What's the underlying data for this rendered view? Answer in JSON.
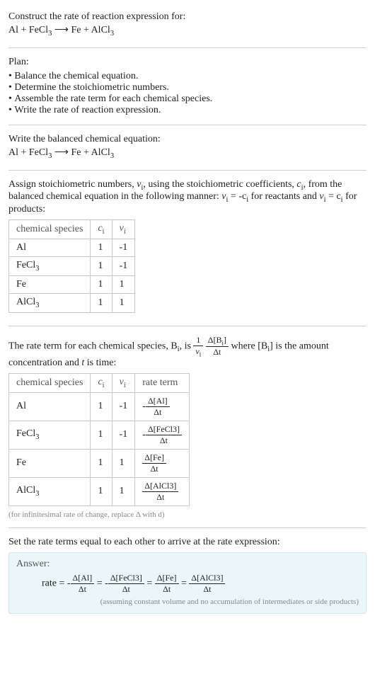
{
  "intro": {
    "title": "Construct the rate of reaction expression for:",
    "equation_lhs": "Al + FeCl",
    "equation_rhs": "Fe + AlCl",
    "sub3": "3",
    "arrow": " ⟶ "
  },
  "plan": {
    "heading": "Plan:",
    "items": [
      "Balance the chemical equation.",
      "Determine the stoichiometric numbers.",
      "Assemble the rate term for each chemical species.",
      "Write the rate of reaction expression."
    ]
  },
  "balanced": {
    "heading": "Write the balanced chemical equation:",
    "equation_lhs": "Al + FeCl",
    "equation_rhs": "Fe + AlCl",
    "sub3": "3",
    "arrow": " ⟶ "
  },
  "assign": {
    "text1": "Assign stoichiometric numbers, ",
    "nu_i": "ν",
    "sub_i": "i",
    "text2": ", using the stoichiometric coefficients, ",
    "c_i": "c",
    "text3": ", from the balanced chemical equation in the following manner: ",
    "rel_reactants_a": "ν",
    "rel_reactants_b": " = -c",
    "rel_reactants_c": " for reactants and ",
    "rel_products_a": "ν",
    "rel_products_b": " = c",
    "rel_products_c": " for products:"
  },
  "table1": {
    "headers": [
      "chemical species",
      "c",
      "ν"
    ],
    "sub_i": "i",
    "rows": [
      {
        "species": "Al",
        "c": "1",
        "nu": "-1"
      },
      {
        "species": "FeCl",
        "species_sub": "3",
        "c": "1",
        "nu": "-1"
      },
      {
        "species": "Fe",
        "c": "1",
        "nu": "1"
      },
      {
        "species": "AlCl",
        "species_sub": "3",
        "c": "1",
        "nu": "1"
      }
    ]
  },
  "rate_intro": {
    "text1": "The rate term for each chemical species, B",
    "sub_i": "i",
    "text2": ", is ",
    "frac1_num": "1",
    "frac1_den_a": "ν",
    "frac2_num_a": "Δ[B",
    "frac2_num_b": "]",
    "frac2_den": "Δt",
    "text3": " where [B",
    "text4": "] is the amount concentration and ",
    "t": "t",
    "text5": " is time:"
  },
  "table2": {
    "headers": [
      "chemical species",
      "c",
      "ν",
      "rate term"
    ],
    "sub_i": "i",
    "rows": [
      {
        "species": "Al",
        "c": "1",
        "nu": "-1",
        "sign": "-",
        "conc": "Δ[Al]",
        "dt": "Δt"
      },
      {
        "species": "FeCl",
        "species_sub": "3",
        "c": "1",
        "nu": "-1",
        "sign": "-",
        "conc": "Δ[FeCl3]",
        "dt": "Δt"
      },
      {
        "species": "Fe",
        "c": "1",
        "nu": "1",
        "sign": "",
        "conc": "Δ[Fe]",
        "dt": "Δt"
      },
      {
        "species": "AlCl",
        "species_sub": "3",
        "c": "1",
        "nu": "1",
        "sign": "",
        "conc": "Δ[AlCl3]",
        "dt": "Δt"
      }
    ]
  },
  "footnote": "(for infinitesimal rate of change, replace Δ with d)",
  "final": {
    "heading": "Set the rate terms equal to each other to arrive at the rate expression:",
    "answer_label": "Answer:",
    "rate_eq_prefix": "rate = ",
    "terms": [
      {
        "sign": "-",
        "num": "Δ[Al]",
        "den": "Δt"
      },
      {
        "sign": "-",
        "num": "Δ[FeCl3]",
        "den": "Δt"
      },
      {
        "sign": "",
        "num": "Δ[Fe]",
        "den": "Δt"
      },
      {
        "sign": "",
        "num": "Δ[AlCl3]",
        "den": "Δt"
      }
    ],
    "eq": " = ",
    "note": "(assuming constant volume and no accumulation of intermediates or side products)"
  }
}
